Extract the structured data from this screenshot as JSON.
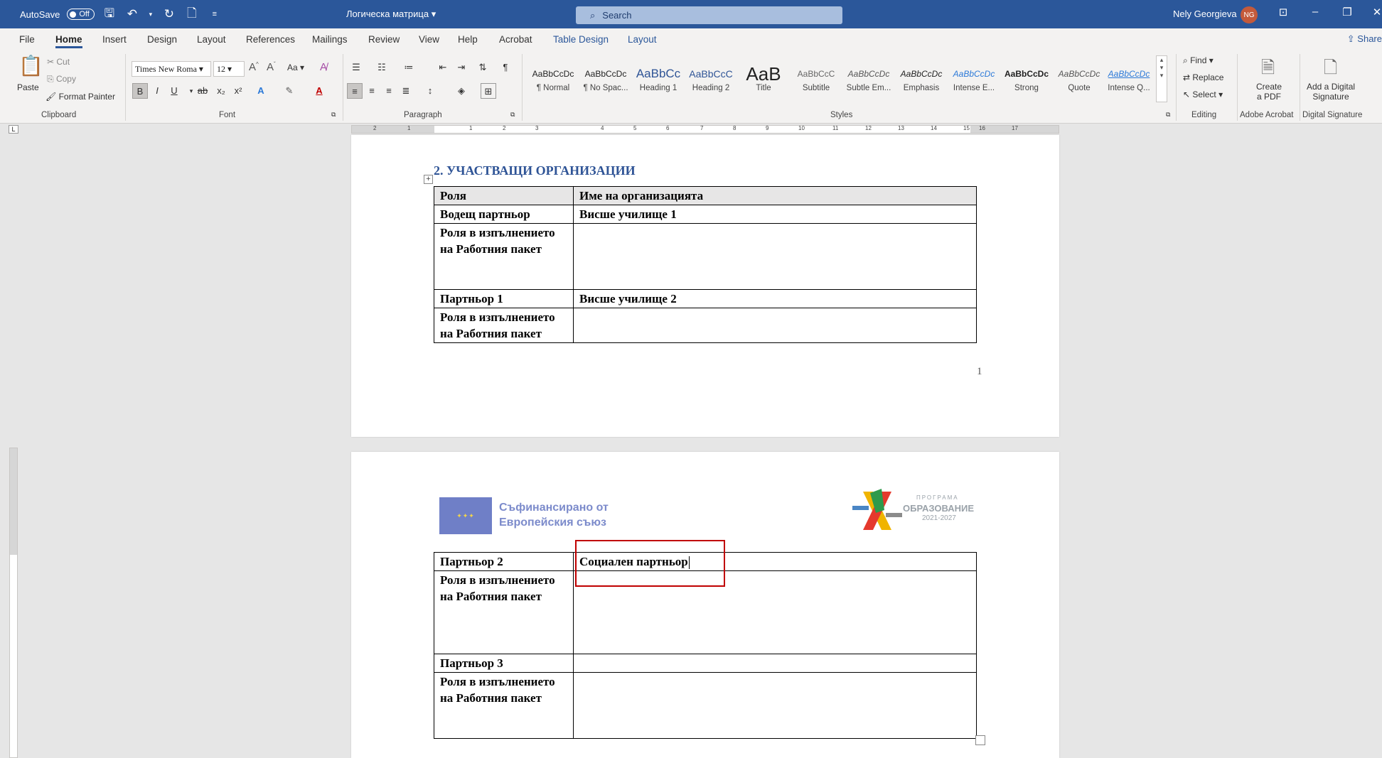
{
  "titlebar": {
    "autosave_label": "AutoSave",
    "autosave_state": "Off",
    "doc_title": "Логическа матрица",
    "search_placeholder": "Search",
    "user_name": "Nely Georgieva",
    "user_initials": "NG"
  },
  "menu": {
    "file": "File",
    "home": "Home",
    "insert": "Insert",
    "design": "Design",
    "layout": "Layout",
    "references": "References",
    "mailings": "Mailings",
    "review": "Review",
    "view": "View",
    "help": "Help",
    "acrobat": "Acrobat",
    "table_design": "Table Design",
    "table_layout": "Layout",
    "share": "Share"
  },
  "ribbon": {
    "clipboard": {
      "paste": "Paste",
      "cut": "Cut",
      "copy": "Copy",
      "format_painter": "Format Painter",
      "label": "Clipboard"
    },
    "font": {
      "name": "Times New Roma",
      "size": "12",
      "change_case": "Aa",
      "label": "Font"
    },
    "paragraph": {
      "label": "Paragraph"
    },
    "styles": {
      "label": "Styles",
      "items": [
        {
          "preview": "AaBbCcDc",
          "name": "¶ Normal"
        },
        {
          "preview": "AaBbCcDc",
          "name": "¶ No Spac..."
        },
        {
          "preview": "AaBbCc",
          "name": "Heading 1"
        },
        {
          "preview": "AaBbCcC",
          "name": "Heading 2"
        },
        {
          "preview": "AaB",
          "name": "Title"
        },
        {
          "preview": "AaBbCcC",
          "name": "Subtitle"
        },
        {
          "preview": "AaBbCcDc",
          "name": "Subtle Em..."
        },
        {
          "preview": "AaBbCcDc",
          "name": "Emphasis"
        },
        {
          "preview": "AaBbCcDc",
          "name": "Intense E..."
        },
        {
          "preview": "AaBbCcDc",
          "name": "Strong"
        },
        {
          "preview": "AaBbCcDc",
          "name": "Quote"
        },
        {
          "preview": "AaBbCcDc",
          "name": "Intense Q..."
        }
      ]
    },
    "editing": {
      "find": "Find",
      "replace": "Replace",
      "select": "Select",
      "label": "Editing"
    },
    "acrobat": {
      "create_pdf_1": "Create",
      "create_pdf_2": "a PDF",
      "label": "Adobe Acrobat"
    },
    "signature": {
      "add_1": "Add a Digital",
      "add_2": "Signature",
      "label": "Digital Signature"
    }
  },
  "ruler_numbers": [
    "2",
    "1",
    "1",
    "2",
    "3",
    "4",
    "5",
    "6",
    "7",
    "8",
    "9",
    "10",
    "11",
    "12",
    "13",
    "14",
    "15",
    "16",
    "17",
    "18"
  ],
  "page1": {
    "heading": "2.  УЧАСТВАЩИ ОРГАНИЗАЦИИ",
    "table": {
      "headers": [
        "Роля",
        "Име на организацията"
      ],
      "rows": [
        [
          "Водещ партньор",
          "Висше училище 1"
        ],
        [
          "Роля в изпълнението на Работния пакет",
          ""
        ],
        [
          "Партньор 1",
          "Висше училище 2"
        ],
        [
          "Роля в изпълнението на Работния пакет",
          ""
        ]
      ]
    },
    "page_number": "1"
  },
  "page2": {
    "eu_text_1": "Съфинансирано от",
    "eu_text_2": "Европейския съюз",
    "prog_small": "ПРОГРАМА",
    "prog_main": "ОБРАЗОВАНИЕ",
    "prog_years": "2021-2027",
    "table": {
      "rows": [
        [
          "Партньор 2",
          "Социален партньор"
        ],
        [
          "Роля в изпълнението на Работния пакет",
          ""
        ],
        [
          "Партньор 3",
          ""
        ],
        [
          "Роля в изпълнението на Работния пакет",
          ""
        ]
      ]
    }
  },
  "colors": {
    "word_blue": "#2b579a",
    "heading_blue": "#2f5496",
    "highlight_red": "#c00000"
  }
}
